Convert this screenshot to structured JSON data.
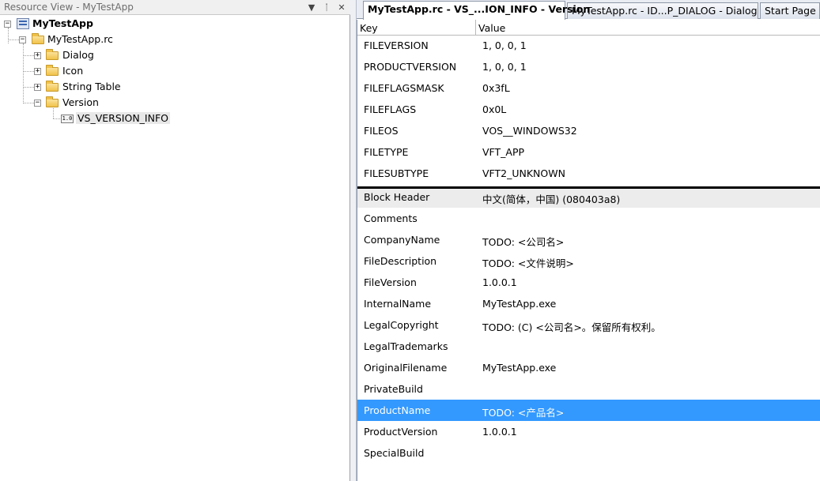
{
  "resource_view": {
    "title": "Resource View - MyTestApp",
    "dropdown_glyph": "▼",
    "pin_glyph": "ᛙ",
    "close_glyph": "✕",
    "tree": {
      "root": "MyTestApp",
      "rc_file": "MyTestApp.rc",
      "folders": [
        "Dialog",
        "Icon",
        "String Table",
        "Version"
      ],
      "version_item": "VS_VERSION_INFO",
      "version_icon_text": "1.0"
    }
  },
  "tabs": [
    {
      "label": "MyTestApp.rc - VS_...ION_INFO - Version",
      "active": true
    },
    {
      "label": "MyTestApp.rc - ID...P_DIALOG - Dialog",
      "active": false
    },
    {
      "label": "Start Page",
      "active": false
    }
  ],
  "grid": {
    "columns": [
      "Key",
      "Value"
    ],
    "fixed_rows": [
      {
        "key": "FILEVERSION",
        "value": "1, 0, 0, 1"
      },
      {
        "key": "PRODUCTVERSION",
        "value": "1, 0, 0, 1"
      },
      {
        "key": "FILEFLAGSMASK",
        "value": "0x3fL"
      },
      {
        "key": "FILEFLAGS",
        "value": "0x0L"
      },
      {
        "key": "FILEOS",
        "value": "VOS__WINDOWS32"
      },
      {
        "key": "FILETYPE",
        "value": "VFT_APP"
      },
      {
        "key": "FILESUBTYPE",
        "value": "VFT2_UNKNOWN"
      }
    ],
    "block_rows": [
      {
        "key": "Block Header",
        "value": "中文(简体，中国) (080403a8)",
        "state": "header"
      },
      {
        "key": "Comments",
        "value": ""
      },
      {
        "key": "CompanyName",
        "value": "TODO: <公司名>"
      },
      {
        "key": "FileDescription",
        "value": "TODO: <文件说明>"
      },
      {
        "key": "FileVersion",
        "value": "1.0.0.1"
      },
      {
        "key": "InternalName",
        "value": "MyTestApp.exe"
      },
      {
        "key": "LegalCopyright",
        "value": "TODO: (C) <公司名>。保留所有权利。"
      },
      {
        "key": "LegalTrademarks",
        "value": ""
      },
      {
        "key": "OriginalFilename",
        "value": "MyTestApp.exe"
      },
      {
        "key": "PrivateBuild",
        "value": ""
      },
      {
        "key": "ProductName",
        "value": "TODO: <产品名>",
        "state": "selected"
      },
      {
        "key": "ProductVersion",
        "value": "1.0.0.1"
      },
      {
        "key": "SpecialBuild",
        "value": ""
      }
    ]
  },
  "colors": {
    "selection": "#3399ff",
    "header_row": "#ececec",
    "pane_title": "#6d6d6d"
  }
}
